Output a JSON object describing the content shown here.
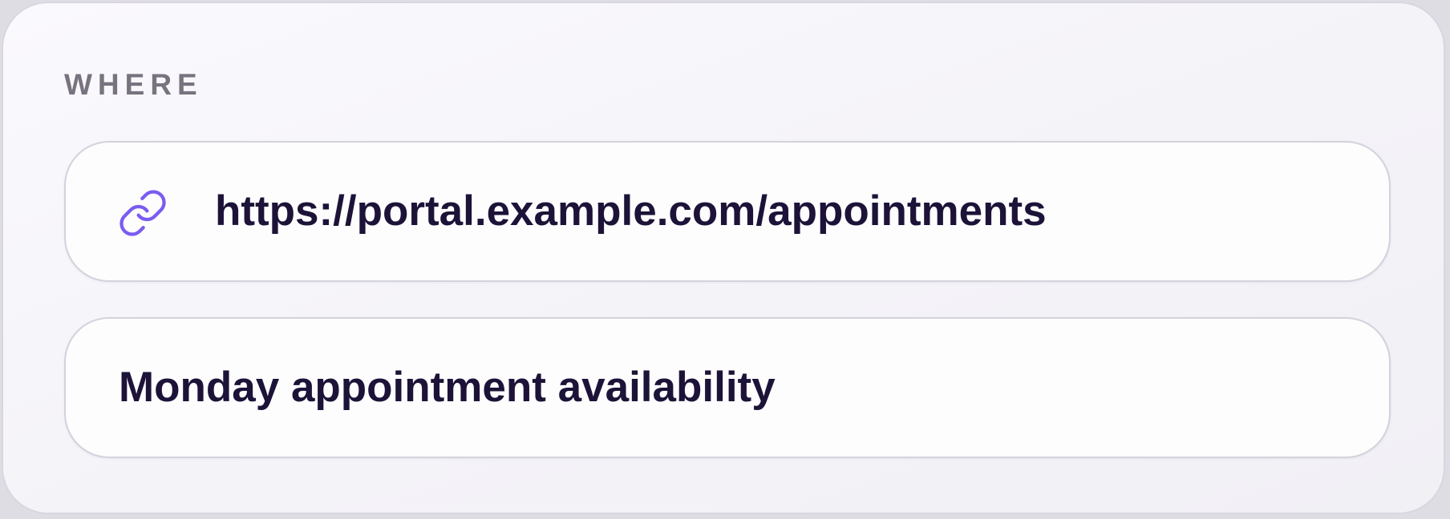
{
  "section": {
    "label": "WHERE"
  },
  "url_field": {
    "icon": "link-icon",
    "value": "https://portal.example.com/appointments"
  },
  "title_field": {
    "value": "Monday appointment availability"
  },
  "colors": {
    "accent_icon": "#7b5cf0",
    "text": "#1d1338",
    "label": "#78737f"
  }
}
